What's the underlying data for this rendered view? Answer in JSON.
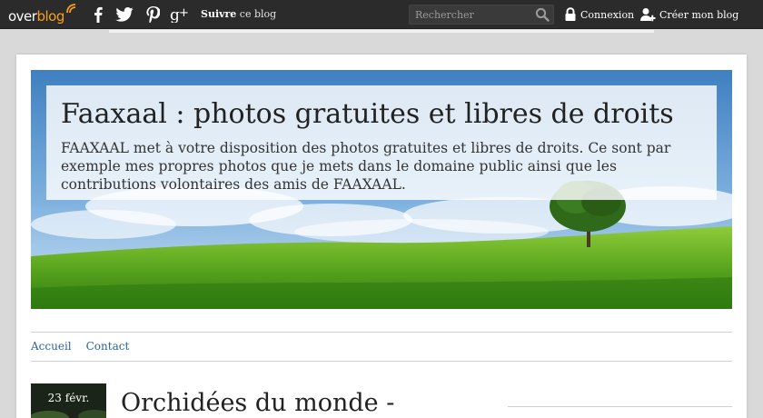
{
  "topbar": {
    "logo_over": "over",
    "logo_blog": "blog",
    "social": [
      {
        "name": "facebook-icon"
      },
      {
        "name": "twitter-icon"
      },
      {
        "name": "pinterest-icon"
      },
      {
        "name": "google-plus-icon"
      }
    ],
    "follow_bold": "Suivre",
    "follow_rest": " ce blog",
    "search_placeholder": "Rechercher",
    "login_label": "Connexion",
    "create_label": "Créer mon blog"
  },
  "header": {
    "title": "Faaxaal : photos gratuites et libres de droits",
    "description": "FAAXAAL met à votre disposition des photos gratuites et libres de droits. Ce sont par exemple mes propres photos que je mets dans le domaine public ainsi que les contributions volontaires des amis de FAAXAAL."
  },
  "nav": {
    "items": [
      {
        "label": "Accueil"
      },
      {
        "label": "Contact"
      }
    ]
  },
  "post": {
    "date": "23 févr.",
    "title": "Orchidées du monde -"
  },
  "colors": {
    "topbar": "#2b2b2b",
    "logo_accent": "#f5a01a",
    "link": "#2a6496",
    "page_bg": "#d9d9d9"
  }
}
